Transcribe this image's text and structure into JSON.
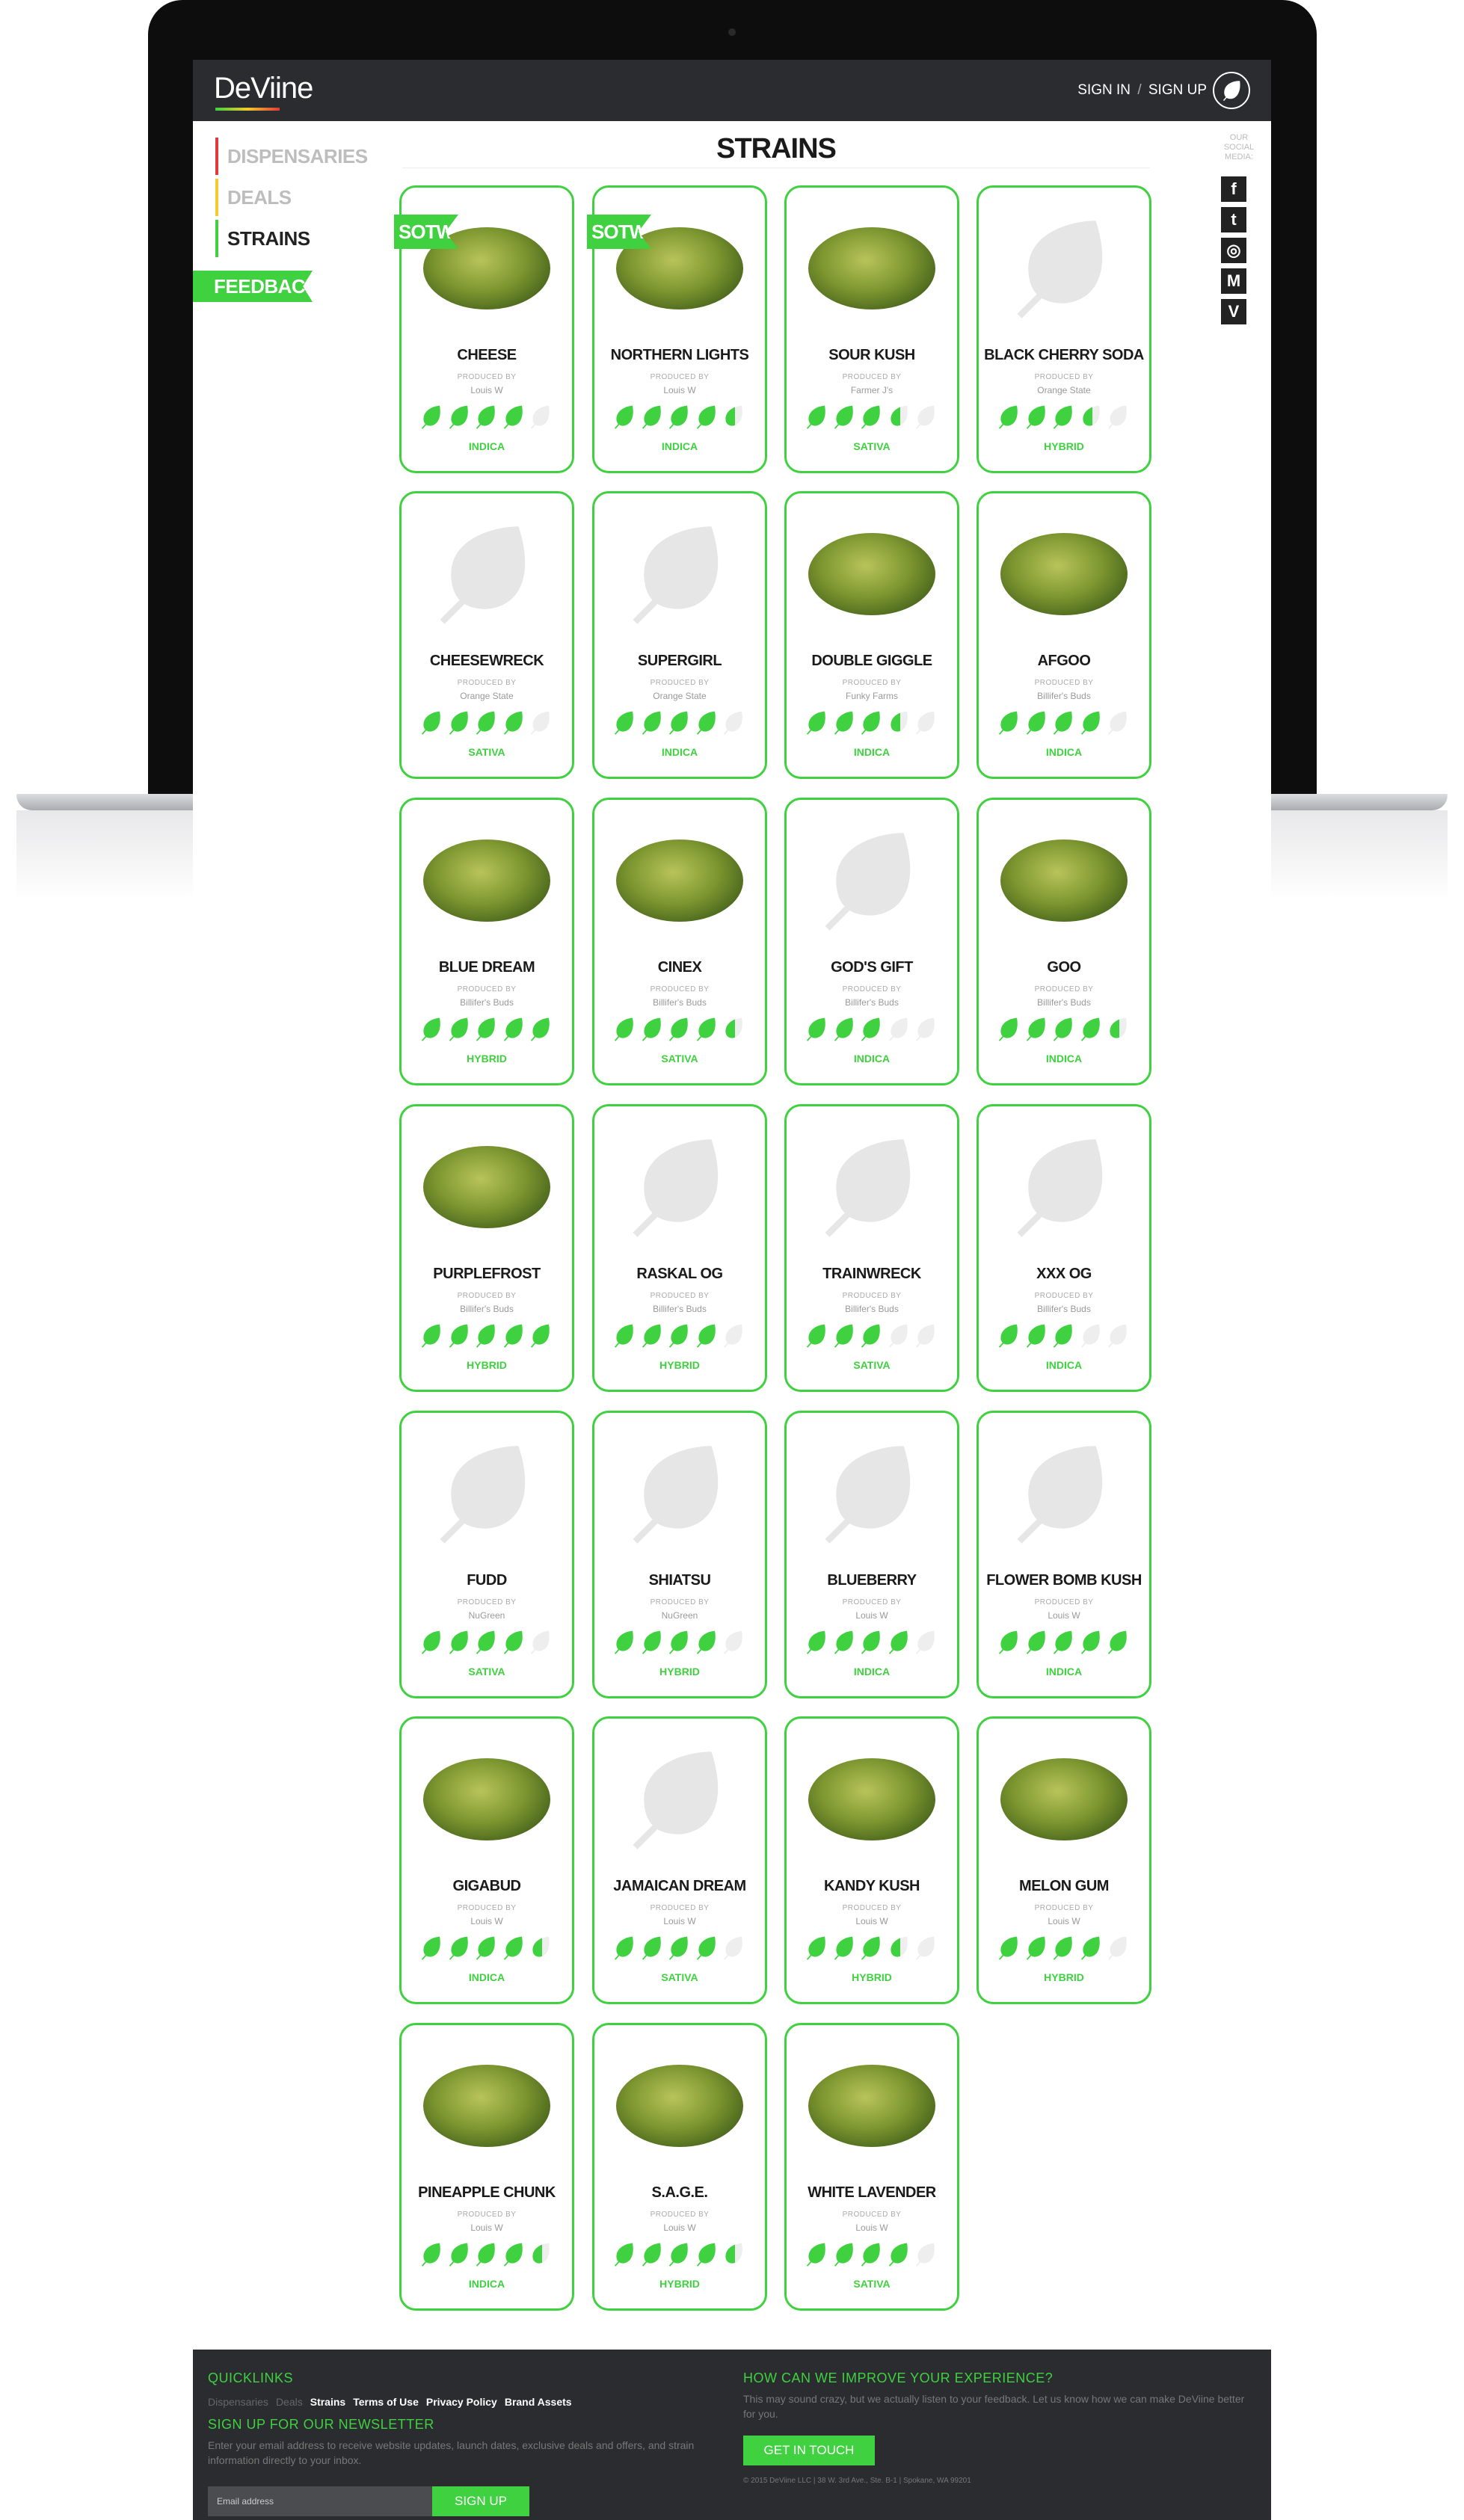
{
  "brand": {
    "logo": "DeViine"
  },
  "header": {
    "sign_in": "SIGN IN",
    "separator": "/",
    "sign_up": "SIGN UP"
  },
  "nav": {
    "dispensaries": "DISPENSARIES",
    "deals": "DEALS",
    "strains": "STRAINS",
    "feedback": "FEEDBACK"
  },
  "social": {
    "label": "OUR SOCIAL MEDIA:",
    "icons": [
      "facebook-icon",
      "twitter-icon",
      "instagram-icon",
      "medium-icon",
      "vine-icon"
    ],
    "glyphs": [
      "f",
      "t",
      "◎",
      "M",
      "V"
    ]
  },
  "page": {
    "title": "STRAINS",
    "produced_by": "PRODUCED BY"
  },
  "colors": {
    "accent": "#3fd13f",
    "dark": "#2a2c2f",
    "indica": "#3fd13f"
  },
  "strains": [
    {
      "name": "CHEESE",
      "maker": "Louis W",
      "type": "INDICA",
      "rating": 4,
      "photo": true,
      "sotw": "SOTW"
    },
    {
      "name": "NORTHERN LIGHTS",
      "maker": "Louis W",
      "type": "INDICA",
      "rating": 4.5,
      "photo": true,
      "sotw": "SOTW"
    },
    {
      "name": "SOUR KUSH",
      "maker": "Farmer J's",
      "type": "SATIVA",
      "rating": 3.5,
      "photo": true
    },
    {
      "name": "BLACK CHERRY SODA",
      "maker": "Orange State",
      "type": "HYBRID",
      "rating": 3.5,
      "photo": false
    },
    {
      "name": "CHEESEWRECK",
      "maker": "Orange State",
      "type": "SATIVA",
      "rating": 4,
      "photo": false
    },
    {
      "name": "SUPERGIRL",
      "maker": "Orange State",
      "type": "INDICA",
      "rating": 4,
      "photo": false
    },
    {
      "name": "DOUBLE GIGGLE",
      "maker": "Funky Farms",
      "type": "INDICA",
      "rating": 3.5,
      "photo": true
    },
    {
      "name": "AFGOO",
      "maker": "Billifer's Buds",
      "type": "INDICA",
      "rating": 4,
      "photo": true
    },
    {
      "name": "BLUE DREAM",
      "maker": "Billifer's Buds",
      "type": "HYBRID",
      "rating": 5,
      "photo": true
    },
    {
      "name": "CINEX",
      "maker": "Billifer's Buds",
      "type": "SATIVA",
      "rating": 4.5,
      "photo": true
    },
    {
      "name": "GOD'S GIFT",
      "maker": "Billifer's Buds",
      "type": "INDICA",
      "rating": 3,
      "photo": false
    },
    {
      "name": "GOO",
      "maker": "Billifer's Buds",
      "type": "INDICA",
      "rating": 4.5,
      "photo": true
    },
    {
      "name": "PURPLEFROST",
      "maker": "Billifer's Buds",
      "type": "HYBRID",
      "rating": 5,
      "photo": true
    },
    {
      "name": "RASKAL OG",
      "maker": "Billifer's Buds",
      "type": "HYBRID",
      "rating": 4,
      "photo": false
    },
    {
      "name": "TRAINWRECK",
      "maker": "Billifer's Buds",
      "type": "SATIVA",
      "rating": 3,
      "photo": false
    },
    {
      "name": "XXX OG",
      "maker": "Billifer's Buds",
      "type": "INDICA",
      "rating": 3,
      "photo": false
    },
    {
      "name": "FUDD",
      "maker": "NuGreen",
      "type": "SATIVA",
      "rating": 4,
      "photo": false
    },
    {
      "name": "SHIATSU",
      "maker": "NuGreen",
      "type": "HYBRID",
      "rating": 4,
      "photo": false
    },
    {
      "name": "BLUEBERRY",
      "maker": "Louis W",
      "type": "INDICA",
      "rating": 4,
      "photo": false
    },
    {
      "name": "FLOWER BOMB KUSH",
      "maker": "Louis W",
      "type": "INDICA",
      "rating": 5,
      "photo": false
    },
    {
      "name": "GIGABUD",
      "maker": "Louis W",
      "type": "INDICA",
      "rating": 4.5,
      "photo": true
    },
    {
      "name": "JAMAICAN DREAM",
      "maker": "Louis W",
      "type": "SATIVA",
      "rating": 4,
      "photo": false
    },
    {
      "name": "KANDY KUSH",
      "maker": "Louis W",
      "type": "HYBRID",
      "rating": 3.5,
      "photo": true
    },
    {
      "name": "MELON GUM",
      "maker": "Louis W",
      "type": "HYBRID",
      "rating": 4,
      "photo": true
    },
    {
      "name": "PINEAPPLE CHUNK",
      "maker": "Louis W",
      "type": "INDICA",
      "rating": 4.5,
      "photo": true
    },
    {
      "name": "S.A.G.E.",
      "maker": "Louis W",
      "type": "HYBRID",
      "rating": 4.5,
      "photo": true
    },
    {
      "name": "WHITE LAVENDER",
      "maker": "Louis W",
      "type": "SATIVA",
      "rating": 4,
      "photo": true
    }
  ],
  "footer": {
    "quicklinks_title": "QUICKLINKS",
    "links": [
      {
        "label": "Dispensaries",
        "active": false
      },
      {
        "label": "Deals",
        "active": false
      },
      {
        "label": "Strains",
        "active": true
      },
      {
        "label": "Terms of Use",
        "active": true
      },
      {
        "label": "Privacy Policy",
        "active": true
      },
      {
        "label": "Brand Assets",
        "active": true
      }
    ],
    "newsletter_title": "SIGN UP FOR OUR NEWSLETTER",
    "newsletter_text": "Enter your email address to receive website updates, launch dates, exclusive deals and offers, and strain information directly to your inbox.",
    "email_placeholder": "Email address",
    "signup_button": "SIGN UP",
    "improve_title": "HOW CAN WE IMPROVE YOUR EXPERIENCE?",
    "improve_text": "This may sound crazy, but we actually listen to your feedback. Let us know how we can make DeViine better for you.",
    "contact_button": "GET IN TOUCH",
    "copyright": "© 2015 DeViine LLC | 38 W. 3rd Ave., Ste. B-1 | Spokane, WA 99201"
  }
}
